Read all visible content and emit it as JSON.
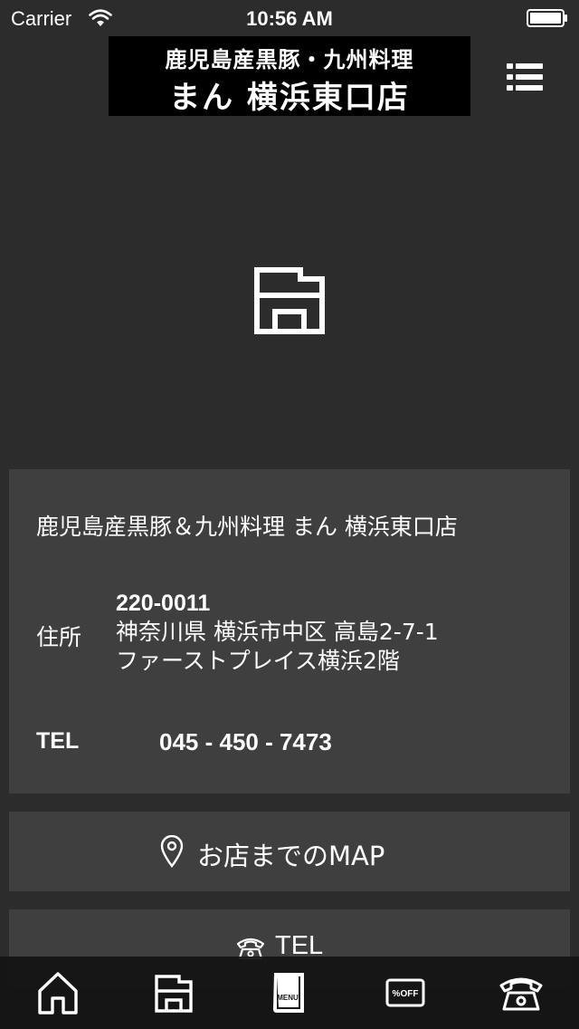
{
  "status_bar": {
    "carrier": "Carrier",
    "time": "10:56 AM"
  },
  "header": {
    "logo_line1": "鹿児島産黒豚・九州料理",
    "logo_line2": "まん 横浜東口店",
    "menu_icon": "list-menu-icon"
  },
  "hero": {
    "icon": "store-icon"
  },
  "shop": {
    "name": "鹿児島産黒豚＆九州料理 まん 横浜東口店",
    "address_label": "住所",
    "postal_code": "220-0011",
    "address_line1": "神奈川県 横浜市中区 高島2-7-1",
    "address_line2": "ファーストプレイス横浜2階",
    "tel_label": "TEL",
    "tel_value": "045 - 450 - 7473"
  },
  "actions": {
    "map_label": "お店までのMAP",
    "tel_label": "TEL"
  },
  "tab_bar": {
    "menu_book_text": "MENU",
    "coupon_text": "%OFF",
    "tabs": [
      "home-icon",
      "store-icon",
      "menu-book-icon",
      "coupon-icon",
      "phone-icon"
    ]
  },
  "colors": {
    "background": "#2c2c2c",
    "card": "#3f3f3f",
    "text": "#ffffff",
    "logo_bg": "#000000"
  }
}
